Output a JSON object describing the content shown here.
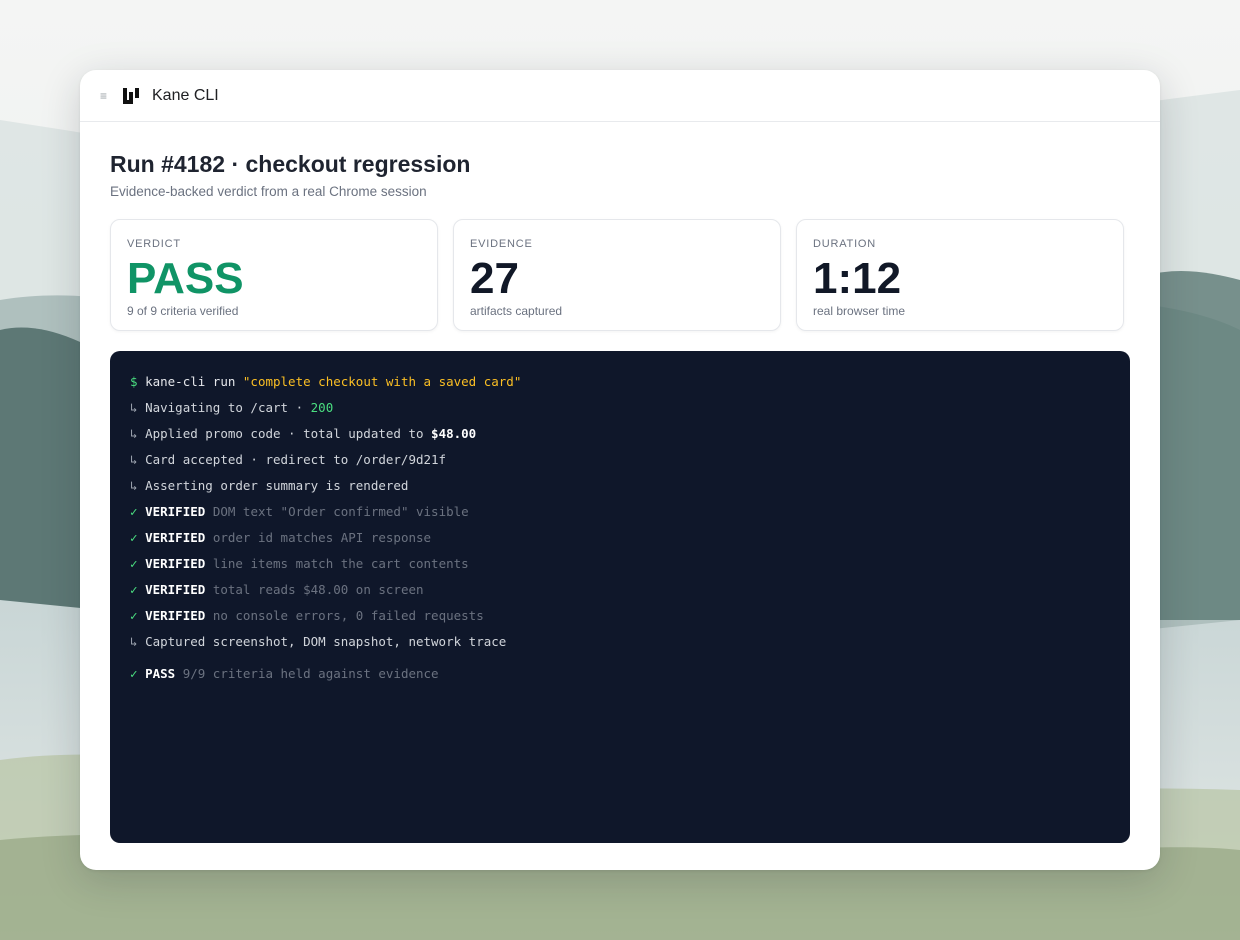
{
  "app": {
    "title": "Kane CLI"
  },
  "header": {
    "title": "Run #4182 · checkout regression",
    "subtitle": "Evidence-backed verdict from a real Chrome session"
  },
  "stats": [
    {
      "label": "VERDICT",
      "value": "PASS",
      "caption": "9 of 9 criteria verified"
    },
    {
      "label": "EVIDENCE",
      "value": "27",
      "caption": "artifacts captured"
    },
    {
      "label": "DURATION",
      "value": "1:12",
      "caption": "real browser time"
    }
  ],
  "terminal": {
    "prompt": "$",
    "command": "kane-cli run",
    "command_arg": "\"complete checkout with a saved card\"",
    "arrow": "↳",
    "check": "✓",
    "steps": [
      {
        "text": "Navigating to /cart · ",
        "highlight": "200"
      },
      {
        "text": "Applied promo code · total updated to ",
        "highlight": "$48.00"
      },
      {
        "text": "Card accepted · redirect to /order/9d21f"
      },
      {
        "text": "Asserting order summary is rendered"
      }
    ],
    "verified_label": "VERIFIED",
    "verifications": [
      "DOM text \"Order confirmed\" visible",
      "order id matches API response",
      "line items match the cart contents",
      "total reads $48.00 on screen",
      "no console errors, 0 failed requests"
    ],
    "captured": "Captured screenshot, DOM snapshot, network trace",
    "result_label": "PASS",
    "result_text": "9/9 criteria held against evidence"
  },
  "colors": {
    "pass": "#109466",
    "terminal_bg": "#0f172a",
    "prompt_green": "#4ade80",
    "string_yellow": "#fbbf24"
  },
  "icons": [
    "menu-icon",
    "kane-logo-icon"
  ]
}
